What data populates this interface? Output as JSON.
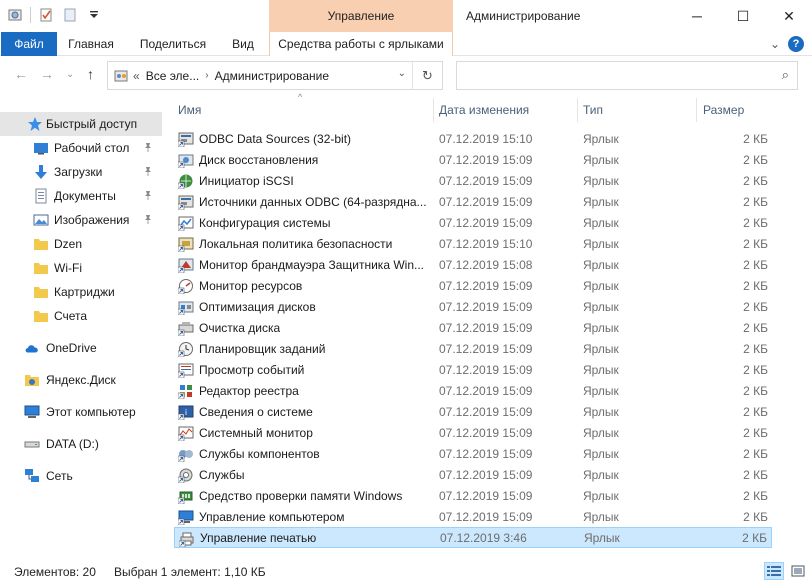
{
  "window": {
    "title": "Администрирование",
    "context_group": "Управление",
    "minimize": "─",
    "maximize": "☐",
    "close": "✕"
  },
  "ribbon": {
    "tabs": [
      "Файл",
      "Главная",
      "Поделиться",
      "Вид",
      "Средства работы с ярлыками"
    ],
    "expand": "⌄",
    "help": "?"
  },
  "nav": {
    "back": "←",
    "forward": "→",
    "recent": "⌄",
    "up": "↑",
    "overflow": "«",
    "crumbs": [
      "Все эле...",
      "Администрирование"
    ],
    "separator": "›",
    "dropdown": "⌄",
    "refresh": "↻",
    "search_placeholder": "",
    "search_icon": "⌕"
  },
  "sidebar": {
    "pin_glyph": "📌",
    "items": [
      {
        "label": "Быстрый доступ",
        "icon": "star-icon",
        "pinned": false
      },
      {
        "label": "Рабочий стол",
        "icon": "desktop-icon",
        "pinned": true
      },
      {
        "label": "Загрузки",
        "icon": "download-icon",
        "pinned": true
      },
      {
        "label": "Документы",
        "icon": "documents-icon",
        "pinned": true
      },
      {
        "label": "Изображения",
        "icon": "pictures-icon",
        "pinned": true
      },
      {
        "label": "Dzen",
        "icon": "folder-icon",
        "pinned": false
      },
      {
        "label": "Wi-Fi",
        "icon": "folder-icon",
        "pinned": false
      },
      {
        "label": "Картриджи",
        "icon": "folder-icon",
        "pinned": false
      },
      {
        "label": "Счета",
        "icon": "folder-icon",
        "pinned": false
      },
      {
        "label": "OneDrive",
        "icon": "cloud-icon",
        "pinned": false
      },
      {
        "label": "Яндекс.Диск",
        "icon": "yandex-disk-icon",
        "pinned": false
      },
      {
        "label": "Этот компьютер",
        "icon": "computer-icon",
        "pinned": false
      },
      {
        "label": "DATA (D:)",
        "icon": "drive-icon",
        "pinned": false
      },
      {
        "label": "Сеть",
        "icon": "network-icon",
        "pinned": false
      }
    ]
  },
  "columns": {
    "name": "Имя",
    "date": "Дата изменения",
    "type": "Тип",
    "size": "Размер",
    "sort_indicator": "^"
  },
  "files": [
    {
      "name": "ODBC Data Sources (32-bit)",
      "date": "07.12.2019 15:10",
      "type": "Ярлык",
      "size": "2 КБ"
    },
    {
      "name": "Диск восстановления",
      "date": "07.12.2019 15:09",
      "type": "Ярлык",
      "size": "2 КБ"
    },
    {
      "name": "Инициатор iSCSI",
      "date": "07.12.2019 15:09",
      "type": "Ярлык",
      "size": "2 КБ"
    },
    {
      "name": "Источники данных ODBC (64-разрядна...",
      "date": "07.12.2019 15:09",
      "type": "Ярлык",
      "size": "2 КБ"
    },
    {
      "name": "Конфигурация системы",
      "date": "07.12.2019 15:09",
      "type": "Ярлык",
      "size": "2 КБ"
    },
    {
      "name": "Локальная политика безопасности",
      "date": "07.12.2019 15:10",
      "type": "Ярлык",
      "size": "2 КБ"
    },
    {
      "name": "Монитор брандмауэра Защитника Win...",
      "date": "07.12.2019 15:08",
      "type": "Ярлык",
      "size": "2 КБ"
    },
    {
      "name": "Монитор ресурсов",
      "date": "07.12.2019 15:09",
      "type": "Ярлык",
      "size": "2 КБ"
    },
    {
      "name": "Оптимизация дисков",
      "date": "07.12.2019 15:09",
      "type": "Ярлык",
      "size": "2 КБ"
    },
    {
      "name": "Очистка диска",
      "date": "07.12.2019 15:09",
      "type": "Ярлык",
      "size": "2 КБ"
    },
    {
      "name": "Планировщик заданий",
      "date": "07.12.2019 15:09",
      "type": "Ярлык",
      "size": "2 КБ"
    },
    {
      "name": "Просмотр событий",
      "date": "07.12.2019 15:09",
      "type": "Ярлык",
      "size": "2 КБ"
    },
    {
      "name": "Редактор реестра",
      "date": "07.12.2019 15:09",
      "type": "Ярлык",
      "size": "2 КБ"
    },
    {
      "name": "Сведения о системе",
      "date": "07.12.2019 15:09",
      "type": "Ярлык",
      "size": "2 КБ"
    },
    {
      "name": "Системный монитор",
      "date": "07.12.2019 15:09",
      "type": "Ярлык",
      "size": "2 КБ"
    },
    {
      "name": "Службы компонентов",
      "date": "07.12.2019 15:09",
      "type": "Ярлык",
      "size": "2 КБ"
    },
    {
      "name": "Службы",
      "date": "07.12.2019 15:09",
      "type": "Ярлык",
      "size": "2 КБ"
    },
    {
      "name": "Средство проверки памяти Windows",
      "date": "07.12.2019 15:09",
      "type": "Ярлык",
      "size": "2 КБ"
    },
    {
      "name": "Управление компьютером",
      "date": "07.12.2019 15:09",
      "type": "Ярлык",
      "size": "2 КБ"
    },
    {
      "name": "Управление печатью",
      "date": "07.12.2019 3:46",
      "type": "Ярлык",
      "size": "2 КБ",
      "selected": true
    }
  ],
  "status": {
    "count": "Элементов: 20",
    "selection": "Выбран 1 элемент: 1,10 КБ"
  },
  "colors": {
    "accent": "#1a6bc2",
    "context_tab": "#f8cfb0",
    "selection": "#cce8ff",
    "selection_border": "#99d1ff",
    "folder": "#f2c94c"
  }
}
